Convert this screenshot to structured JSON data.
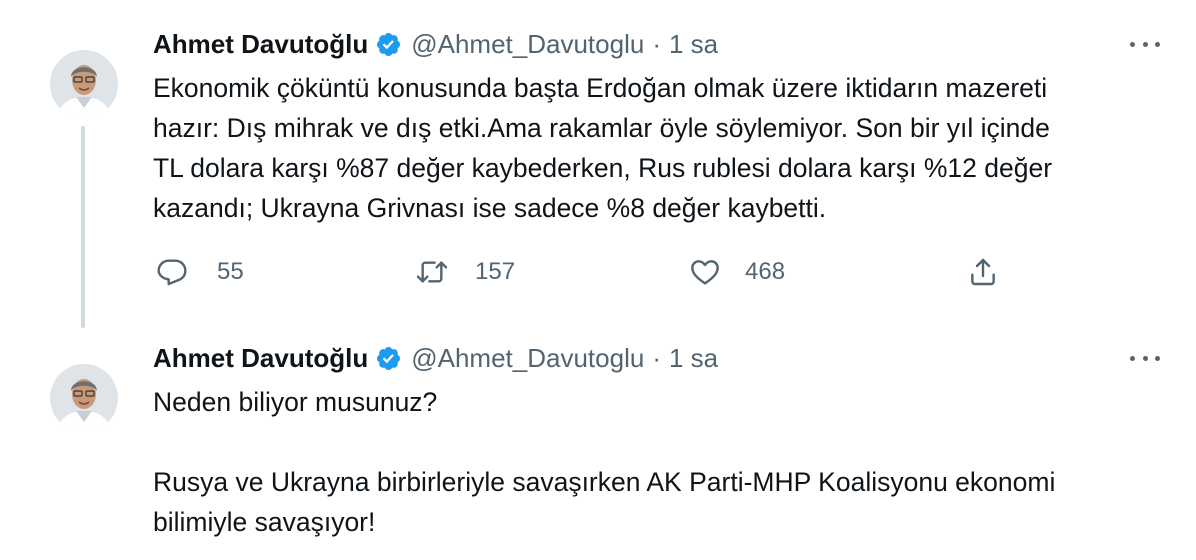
{
  "tweets": [
    {
      "author": {
        "name": "Ahmet Davutoğlu",
        "handle": "@Ahmet_Davutoglu",
        "separator": "·",
        "time": "1 sa"
      },
      "text": "Ekonomik çöküntü konusunda başta Erdoğan olmak üzere iktidarın mazereti\nhazır: Dış mihrak ve dış etki.Ama rakamlar öyle söylemiyor. Son bir yıl içinde\nTL dolara karşı %87 değer kaybederken, Rus rublesi dolara karşı %12 değer\nkazandı; Ukrayna Grivnası ise sadece %8 değer kaybetti.",
      "stats": {
        "replies": "55",
        "retweets": "157",
        "likes": "468"
      }
    },
    {
      "author": {
        "name": "Ahmet Davutoğlu",
        "handle": "@Ahmet_Davutoglu",
        "separator": "·",
        "time": "1 sa"
      },
      "text": "Neden biliyor musunuz?\n\nRusya ve Ukrayna birbirleriyle savaşırken AK Parti-MHP Koalisyonu ekonomi\nbilimiyle savaşıyor!"
    }
  ],
  "colors": {
    "verified": "#1d9bf0",
    "secondary_text": "#536471",
    "thread_line": "#cfd9de"
  },
  "icons": {
    "verified": "verified-badge-icon",
    "more": "more-dots-icon",
    "reply": "reply-icon",
    "retweet": "retweet-icon",
    "like": "heart-icon",
    "share": "share-icon"
  }
}
